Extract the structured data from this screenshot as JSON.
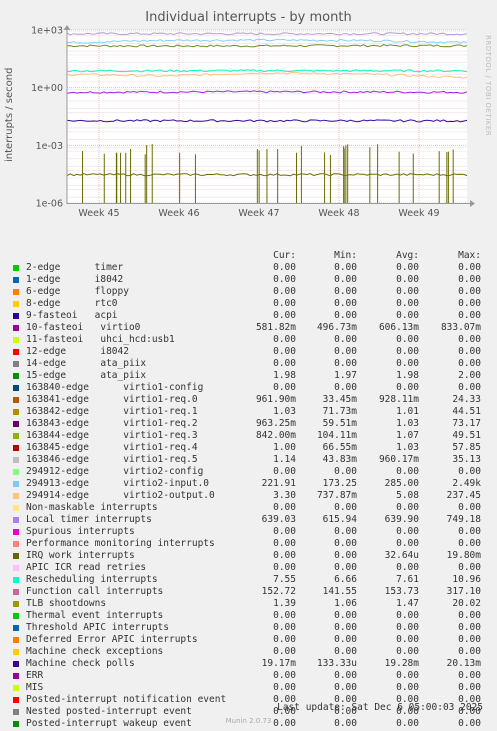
{
  "chart_data": {
    "type": "line",
    "title": "Individual interrupts - by month",
    "ylabel": "interrupts / second",
    "yscale": "log",
    "ylim": [
      1e-06,
      1000
    ],
    "yticks": [
      "1e+03",
      "1e+00",
      "1e-03",
      "1e-06"
    ],
    "xticks": [
      "Week 45",
      "Week 46",
      "Week 47",
      "Week 48",
      "Week 49"
    ],
    "grid": true,
    "series": [
      {
        "name": "Function call interrupts",
        "color": "#6b8e23",
        "values": [
          152,
          148,
          150,
          155,
          153
        ]
      },
      {
        "name": "10-fasteoi virtio0",
        "color": "#a020f0",
        "values": [
          0.58,
          0.6,
          0.61,
          0.6,
          0.58
        ]
      },
      {
        "name": "Local timer interrupts",
        "color": "#b19cd9",
        "values": [
          639,
          640,
          638,
          641,
          639
        ]
      },
      {
        "name": "294913-edge virtio2-input.0",
        "color": "#87cefa",
        "values": [
          221,
          290,
          300,
          285,
          221
        ]
      },
      {
        "name": "294914-edge virtio2-output.0",
        "color": "#ffc080",
        "values": [
          5,
          4,
          6,
          5,
          3.3
        ]
      },
      {
        "name": "Rescheduling interrupts",
        "color": "#00ffc0",
        "values": [
          7.5,
          7.6,
          7.7,
          7.6,
          7.55
        ]
      },
      {
        "name": "Machine check polls",
        "color": "#3a0ca3",
        "values": [
          0.019,
          0.019,
          0.019,
          0.019,
          0.019
        ]
      },
      {
        "name": "IRQ work interrupts",
        "color": "#6b6b00",
        "values": [
          3e-05,
          3e-05,
          3e-05,
          3e-05,
          3e-05
        ]
      }
    ]
  },
  "footer": {
    "last_update": "Last update: Sat Dec  6 05:00:03 2025",
    "munin": "Munin 2.0.73"
  },
  "side_text": "RRDTOOL / TOBI OETIKER",
  "legend": {
    "headers": {
      "cur": "Cur:",
      "min": "Min:",
      "avg": "Avg:",
      "max": "Max:"
    },
    "rows": [
      {
        "name": "2-edge      timer",
        "color": "#00cc00",
        "cur": "0.00",
        "min": "0.00",
        "avg": "0.00",
        "max": "0.00"
      },
      {
        "name": "1-edge      i8042",
        "color": "#0066b3",
        "cur": "0.00",
        "min": "0.00",
        "avg": "0.00",
        "max": "0.00"
      },
      {
        "name": "6-edge      floppy",
        "color": "#ff8000",
        "cur": "0.00",
        "min": "0.00",
        "avg": "0.00",
        "max": "0.00"
      },
      {
        "name": "8-edge      rtc0",
        "color": "#ffcc00",
        "cur": "0.00",
        "min": "0.00",
        "avg": "0.00",
        "max": "0.00"
      },
      {
        "name": "9-fasteoi   acpi",
        "color": "#330099",
        "cur": "0.00",
        "min": "0.00",
        "avg": "0.00",
        "max": "0.00"
      },
      {
        "name": "10-fasteoi   virtio0",
        "color": "#990099",
        "cur": "581.82m",
        "min": "496.73m",
        "avg": "606.13m",
        "max": "833.07m"
      },
      {
        "name": "11-fasteoi   uhci_hcd:usb1",
        "color": "#ccff00",
        "cur": "0.00",
        "min": "0.00",
        "avg": "0.00",
        "max": "0.00"
      },
      {
        "name": "12-edge      i8042",
        "color": "#ff0000",
        "cur": "0.00",
        "min": "0.00",
        "avg": "0.00",
        "max": "0.00"
      },
      {
        "name": "14-edge      ata_piix",
        "color": "#808080",
        "cur": "0.00",
        "min": "0.00",
        "avg": "0.00",
        "max": "0.00"
      },
      {
        "name": "15-edge      ata_piix",
        "color": "#008f00",
        "cur": "1.98",
        "min": "1.97",
        "avg": "1.98",
        "max": "2.00"
      },
      {
        "name": "163840-edge      virtio1-config",
        "color": "#00487d",
        "cur": "0.00",
        "min": "0.00",
        "avg": "0.00",
        "max": "0.00"
      },
      {
        "name": "163841-edge      virtio1-req.0",
        "color": "#b35a00",
        "cur": "961.90m",
        "min": "33.45m",
        "avg": "928.11m",
        "max": "24.33"
      },
      {
        "name": "163842-edge      virtio1-req.1",
        "color": "#b38f00",
        "cur": "1.03",
        "min": "71.73m",
        "avg": "1.01",
        "max": "44.51"
      },
      {
        "name": "163843-edge      virtio1-req.2",
        "color": "#6b006b",
        "cur": "963.25m",
        "min": "59.51m",
        "avg": "1.03",
        "max": "73.17"
      },
      {
        "name": "163844-edge      virtio1-req.3",
        "color": "#8fb300",
        "cur": "842.00m",
        "min": "104.11m",
        "avg": "1.07",
        "max": "49.51"
      },
      {
        "name": "163845-edge      virtio1-req.4",
        "color": "#b30000",
        "cur": "1.00",
        "min": "66.55m",
        "avg": "1.03",
        "max": "57.85"
      },
      {
        "name": "163846-edge      virtio1-req.5",
        "color": "#bebebe",
        "cur": "1.14",
        "min": "43.83m",
        "avg": "960.17m",
        "max": "35.13"
      },
      {
        "name": "294912-edge      virtio2-config",
        "color": "#80ff80",
        "cur": "0.00",
        "min": "0.00",
        "avg": "0.00",
        "max": "0.00"
      },
      {
        "name": "294913-edge      virtio2-input.0",
        "color": "#80c9ff",
        "cur": "221.91",
        "min": "173.25",
        "avg": "285.00",
        "max": "2.49k"
      },
      {
        "name": "294914-edge      virtio2-output.0",
        "color": "#ffc080",
        "cur": "3.30",
        "min": "737.87m",
        "avg": "5.08",
        "max": "237.45"
      },
      {
        "name": "Non-maskable interrupts",
        "color": "#ffe680",
        "cur": "0.00",
        "min": "0.00",
        "avg": "0.00",
        "max": "0.00"
      },
      {
        "name": "Local timer interrupts",
        "color": "#aa80ff",
        "cur": "639.03",
        "min": "615.94",
        "avg": "639.90",
        "max": "749.18"
      },
      {
        "name": "Spurious interrupts",
        "color": "#ee00cc",
        "cur": "0.00",
        "min": "0.00",
        "avg": "0.00",
        "max": "0.00"
      },
      {
        "name": "Performance monitoring interrupts",
        "color": "#ff8080",
        "cur": "0.00",
        "min": "0.00",
        "avg": "0.00",
        "max": "0.00"
      },
      {
        "name": "IRQ work interrupts",
        "color": "#666600",
        "cur": "0.00",
        "min": "0.00",
        "avg": "32.64u",
        "max": "19.80m"
      },
      {
        "name": "APIC ICR read retries",
        "color": "#ffbfff",
        "cur": "0.00",
        "min": "0.00",
        "avg": "0.00",
        "max": "0.00"
      },
      {
        "name": "Rescheduling interrupts",
        "color": "#00ffcc",
        "cur": "7.55",
        "min": "6.66",
        "avg": "7.61",
        "max": "10.96"
      },
      {
        "name": "Function call interrupts",
        "color": "#cc6699",
        "cur": "152.72",
        "min": "141.55",
        "avg": "153.73",
        "max": "317.10"
      },
      {
        "name": "TLB shootdowns",
        "color": "#999900",
        "cur": "1.39",
        "min": "1.06",
        "avg": "1.47",
        "max": "20.02"
      },
      {
        "name": "Thermal event interrupts",
        "color": "#00cc00",
        "cur": "0.00",
        "min": "0.00",
        "avg": "0.00",
        "max": "0.00"
      },
      {
        "name": "Threshold APIC interrupts",
        "color": "#0066b3",
        "cur": "0.00",
        "min": "0.00",
        "avg": "0.00",
        "max": "0.00"
      },
      {
        "name": "Deferred Error APIC interrupts",
        "color": "#ff8000",
        "cur": "0.00",
        "min": "0.00",
        "avg": "0.00",
        "max": "0.00"
      },
      {
        "name": "Machine check exceptions",
        "color": "#ffcc00",
        "cur": "0.00",
        "min": "0.00",
        "avg": "0.00",
        "max": "0.00"
      },
      {
        "name": "Machine check polls",
        "color": "#330099",
        "cur": "19.17m",
        "min": "133.33u",
        "avg": "19.28m",
        "max": "20.13m"
      },
      {
        "name": "ERR",
        "color": "#990099",
        "cur": "0.00",
        "min": "0.00",
        "avg": "0.00",
        "max": "0.00"
      },
      {
        "name": "MIS",
        "color": "#ccff00",
        "cur": "0.00",
        "min": "0.00",
        "avg": "0.00",
        "max": "0.00"
      },
      {
        "name": "Posted-interrupt notification event",
        "color": "#ff0000",
        "cur": "0.00",
        "min": "0.00",
        "avg": "0.00",
        "max": "0.00"
      },
      {
        "name": "Nested posted-interrupt event",
        "color": "#808080",
        "cur": "0.00",
        "min": "0.00",
        "avg": "0.00",
        "max": "0.00"
      },
      {
        "name": "Posted-interrupt wakeup event",
        "color": "#008f00",
        "cur": "0.00",
        "min": "0.00",
        "avg": "0.00",
        "max": "0.00"
      }
    ]
  }
}
